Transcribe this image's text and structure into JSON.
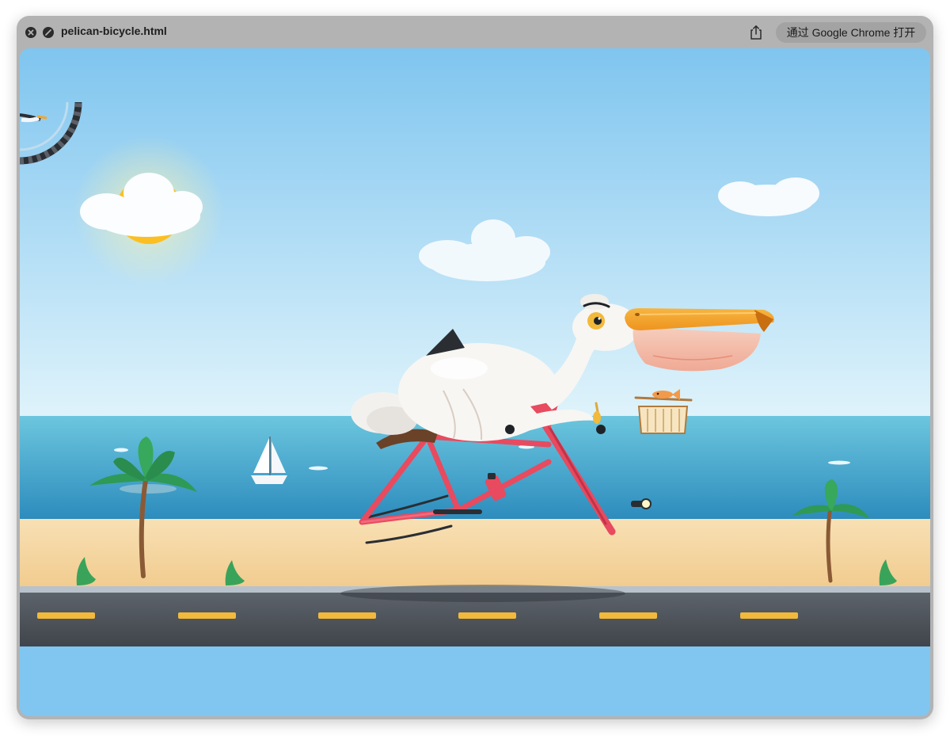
{
  "window": {
    "title": "pelican-bicycle.html",
    "open_button_label": "通过 Google Chrome 打开"
  },
  "icons": {
    "close": "close-icon",
    "stop": "stop-icon",
    "share": "share-icon"
  },
  "colors": {
    "sky_top": "#7fc5ef",
    "sky_bottom": "#dff3fb",
    "sea": "#2f94c1",
    "sand": "#f5d9a6",
    "road": "#4a4f55",
    "road_dash": "#f2b93b",
    "bike_frame": "#e84a5f",
    "beak": "#f4a52b",
    "pouch": "#f3b8a7"
  }
}
